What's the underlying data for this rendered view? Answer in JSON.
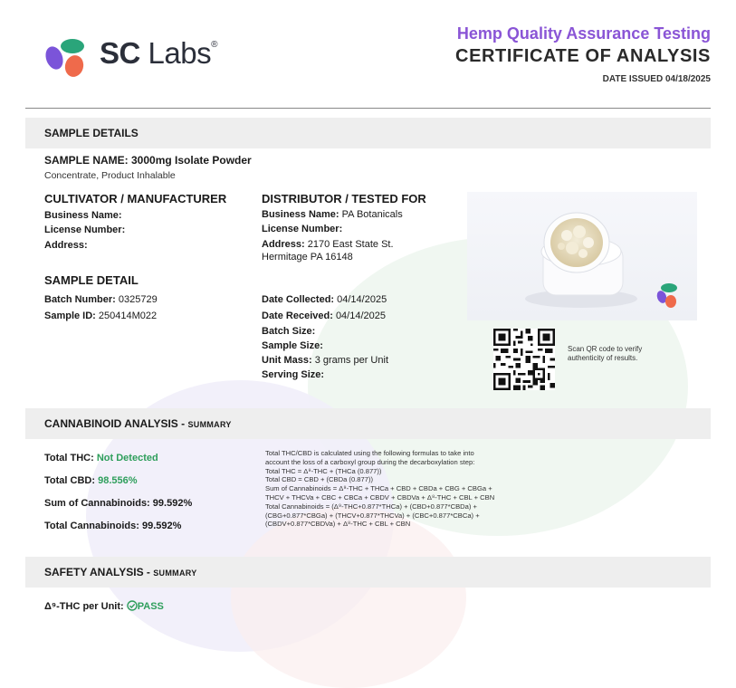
{
  "header": {
    "brand_bold": "SC",
    "brand_light": "Labs",
    "brand_mark": "®",
    "subtitle": "Hemp Quality Assurance Testing",
    "title": "CERTIFICATE OF ANALYSIS",
    "date_issued": "DATE ISSUED 04/18/2025",
    "logo_colors": [
      "#7b54d9",
      "#2aa57a",
      "#ef6a4b"
    ]
  },
  "sample_details": {
    "band_label": "SAMPLE DETAILS",
    "sample_name": "SAMPLE NAME: 3000mg Isolate Powder",
    "sample_type": "Concentrate, Product Inhalable",
    "cultivator": {
      "heading": "CULTIVATOR / MANUFACTURER",
      "business_name_label": "Business Name:",
      "license_label": "License Number:",
      "address_label": "Address:"
    },
    "distributor": {
      "heading": "DISTRIBUTOR / TESTED FOR",
      "business_name_label": "Business Name:",
      "business_name": "PA Botanicals",
      "license_label": "License Number:",
      "address_label": "Address:",
      "address_line1": "2170 East State St.",
      "address_line2": "Hermitage PA 16148"
    },
    "sample_detail": {
      "heading": "SAMPLE DETAIL",
      "batch_number_label": "Batch Number:",
      "batch_number": "0325729",
      "sample_id_label": "Sample ID:",
      "sample_id": "250414M022"
    },
    "dates": {
      "collected_label": "Date Collected:",
      "collected": "04/14/2025",
      "received_label": "Date Received:",
      "received": "04/14/2025",
      "batch_size_label": "Batch Size:",
      "sample_size_label": "Sample Size:",
      "unit_mass_label": "Unit Mass:",
      "unit_mass": "3 grams per Unit",
      "serving_size_label": "Serving Size:"
    },
    "qr_note_line1": "Scan QR code to verify",
    "qr_note_line2": "authenticity of results."
  },
  "cannabinoid": {
    "band_label": "CANNABINOID ANALYSIS - ",
    "band_small": "SUMMARY",
    "total_thc_label": "Total THC:",
    "total_thc": "Not Detected",
    "total_cbd_label": "Total CBD:",
    "total_cbd": "98.556%",
    "sum_label": "Sum of Cannabinoids:",
    "sum": "99.592%",
    "total_label": "Total Cannabinoids:",
    "total": "99.592%",
    "formula_lines": [
      "Total THC/CBD is calculated using the following formulas to take into",
      "account the loss of a carboxyl group during the decarboxylation step:",
      "Total THC = Δ⁹-THC + (THCa (0.877))",
      "Total CBD = CBD + (CBDa (0.877))",
      "Sum of Cannabinoids = Δ⁹-THC + THCa + CBD + CBDa + CBG + CBGa +",
      "THCV + THCVa + CBC + CBCa + CBDV + CBDVa + Δ⁸-THC + CBL + CBN",
      "Total Cannabinoids = (Δ⁹-THC+0.877*THCa) + (CBD+0.877*CBDa) +",
      "(CBG+0.877*CBGa) + (THCV+0.877*THCVa) + (CBC+0.877*CBCa) +",
      "(CBDV+0.877*CBDVa) + Δ⁸-THC + CBL + CBN"
    ]
  },
  "safety": {
    "band_label": "SAFETY ANALYSIS - ",
    "band_small": "SUMMARY",
    "d9_label": "Δ⁹-THC per Unit:",
    "d9_result": "PASS",
    "pass_color": "#2e9e5b"
  }
}
